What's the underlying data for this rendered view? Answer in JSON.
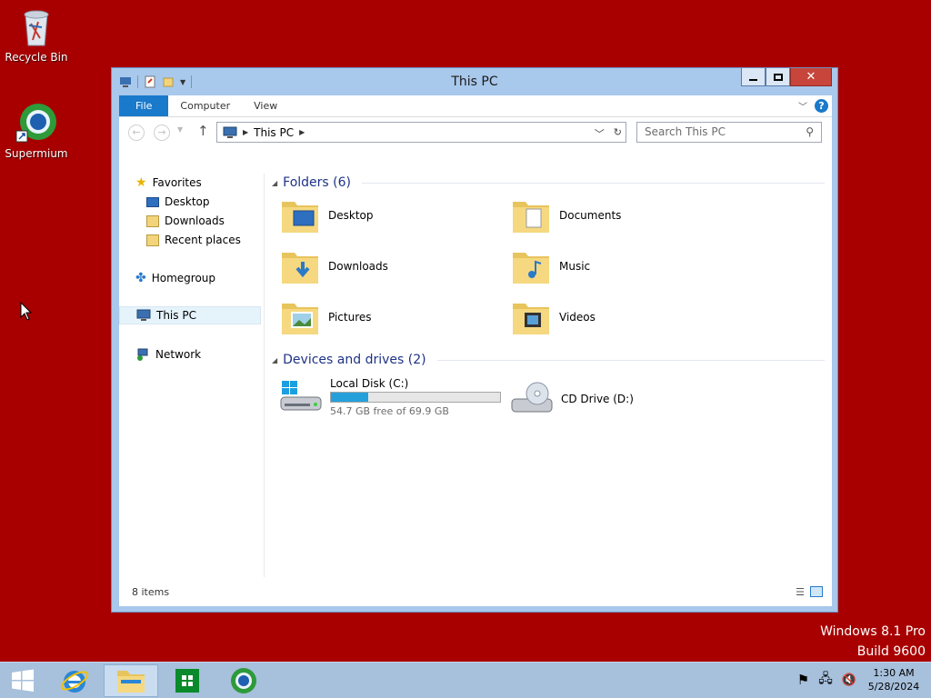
{
  "desktop": {
    "icons": [
      {
        "label": "Recycle Bin"
      },
      {
        "label": "Supermium"
      }
    ],
    "watermark": {
      "line1": "Windows 8.1 Pro",
      "line2": "Build 9600"
    }
  },
  "window": {
    "title": "This PC",
    "ribbon": {
      "tabs": [
        "File",
        "Computer",
        "View"
      ]
    },
    "address": {
      "crumb": "This PC"
    },
    "search": {
      "placeholder": "Search This PC"
    },
    "nav": {
      "favorites": "Favorites",
      "desktop": "Desktop",
      "downloads": "Downloads",
      "recent": "Recent places",
      "homegroup": "Homegroup",
      "thispc": "This PC",
      "network": "Network"
    },
    "folders_header": "Folders (6)",
    "folders": [
      "Desktop",
      "Documents",
      "Downloads",
      "Music",
      "Pictures",
      "Videos"
    ],
    "drives_header": "Devices and drives (2)",
    "drives": [
      {
        "name": "Local Disk (C:)",
        "free": "54.7 GB free of 69.9 GB",
        "used_fraction": 0.218
      },
      {
        "name": "CD Drive (D:)"
      }
    ],
    "status": "8 items"
  },
  "taskbar": {
    "clock_time": "1:30 AM",
    "clock_date": "5/28/2024"
  },
  "colors": {
    "desktop": "#a80000",
    "accent": "#1979ca",
    "bar": "#26a0da"
  }
}
